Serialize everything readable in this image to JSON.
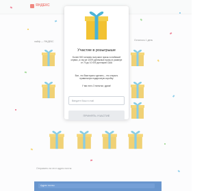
{
  "header": {
    "logo_text": "ЯНДЕКС",
    "logo_icon": "brand-logo-icon"
  },
  "promo": {
    "left_text": "лайф — ЯНДЕКС",
    "right_text": "Осталось 1 день"
  },
  "form": {
    "field_label": "Отправить на этот адрес почты:",
    "bottom_label": "Адрес почты"
  },
  "modal": {
    "title": "Участие в розыгрыше",
    "paragraph_1": "Более 500 человек получают призы в любимой сервис, а так же 100% денежные призы в размере от 70 до 10 000 долларов США",
    "paragraph_2": "Все, что Вам нужно сделать – это открыть правильную подарочную коробку",
    "paragraph_3": "У вас есть 3 попытки, удачи!",
    "email_placeholder": "Введите Ваш e-mail",
    "submit_label": "ПРИНЯТЬ УЧАСТИЕ",
    "gift_icon": "gift-box-icon"
  },
  "colors": {
    "gift_body": "#f2c232",
    "gift_ribbon": "#4ab3d6",
    "brand_red": "#e7473c",
    "bottom_bar": "#1a5fb4",
    "button_bg": "#e9ebee"
  }
}
